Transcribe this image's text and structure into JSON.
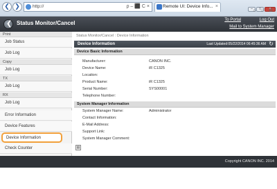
{
  "browser": {
    "address": "http://",
    "address_tools": "ρ – ⬛ C ×",
    "tab_title": "Remote UI: Device Info...",
    "tab_close": "×",
    "back": "❮",
    "forward": "❯",
    "win_min": "–",
    "win_max": "□",
    "win_close": "×",
    "toolbar_icons": "⌂ ☆ ⚙"
  },
  "header": {
    "title": "Status Monitor/Cancel",
    "home_arrow": "❮",
    "to_portal": "To Portal",
    "log_out": "Log Out",
    "mail_link": "Mail to System Manager"
  },
  "sidebar": {
    "groups": [
      {
        "label": "Print",
        "items": [
          {
            "label": "Job Status"
          },
          {
            "label": "Job Log"
          }
        ]
      },
      {
        "label": "Copy",
        "items": [
          {
            "label": "Job Log"
          }
        ]
      },
      {
        "label": "TX",
        "items": [
          {
            "label": "Job Log"
          }
        ]
      },
      {
        "label": "RX",
        "items": [
          {
            "label": "Job Log"
          }
        ]
      }
    ],
    "extra_items": [
      {
        "label": "Error Information"
      },
      {
        "label": "Device Features"
      },
      {
        "label": "Device Information"
      },
      {
        "label": "Check Counter"
      }
    ]
  },
  "main": {
    "breadcrumb": "Status Monitor/Cancel : Device Information",
    "panel_title": "Device Information",
    "last_updated": "Last Updated:05/22/2014 06:45:36 AM",
    "refresh_icon": "↻",
    "sections": [
      {
        "title": "Device Basic Information",
        "fields": [
          {
            "label": "Manufacturer:",
            "value": "CANON INC."
          },
          {
            "label": "Device Name:",
            "value": "iR C1325"
          },
          {
            "label": "Location:",
            "value": ""
          },
          {
            "label": "Product Name:",
            "value": "iR C1325"
          },
          {
            "label": "Serial Number:",
            "value": "SYS00001"
          },
          {
            "label": "Telephone Number:",
            "value": ""
          }
        ]
      },
      {
        "title": "System Manager Information",
        "fields": [
          {
            "label": "System Manager Name:",
            "value": "Administrator"
          },
          {
            "label": "Contact Information:",
            "value": ""
          },
          {
            "label": "E-Mail Address:",
            "value": ""
          },
          {
            "label": "Support Link:",
            "value": ""
          },
          {
            "label": "System Manager Comment:",
            "value": ""
          }
        ]
      }
    ],
    "print_icon": "▤"
  },
  "footer": {
    "copyright": "Copyright CANON INC. 2014"
  }
}
